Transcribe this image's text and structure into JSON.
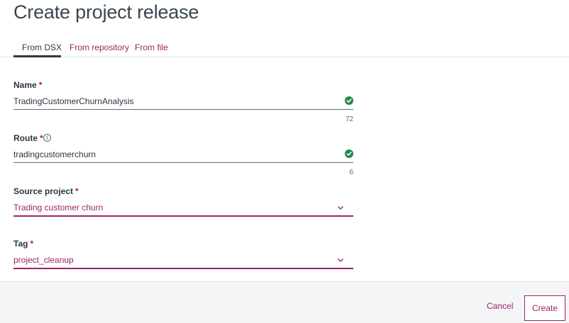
{
  "page": {
    "title": "Create project release"
  },
  "tabs": [
    {
      "label": "From DSX",
      "active": true
    },
    {
      "label": "From repository",
      "active": false
    },
    {
      "label": "From file",
      "active": false
    }
  ],
  "fields": {
    "name": {
      "label": "Name",
      "required": "*",
      "value": "TradingCustomerChurnAnalysis",
      "count": "72",
      "valid": true
    },
    "route": {
      "label": "Route",
      "required": "*",
      "value": "tradingcustomerchurn",
      "count": "6",
      "valid": true
    },
    "source_project": {
      "label": "Source project",
      "required": "*",
      "value": "Trading customer churn"
    },
    "tag": {
      "label": "Tag",
      "required": "*",
      "value": "project_cleanup"
    }
  },
  "icons": {
    "info": "info-icon",
    "check": "checkmark-icon",
    "chevron": "chevron-down-icon"
  },
  "footer": {
    "cancel_label": "Cancel",
    "create_label": "Create"
  },
  "colors": {
    "accent": "#9c2466",
    "success": "#1f8a4c",
    "text": "#2a3540"
  }
}
